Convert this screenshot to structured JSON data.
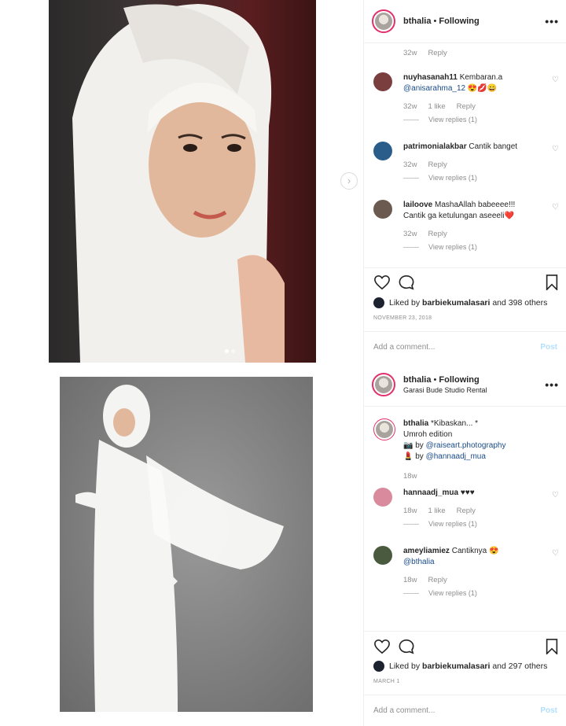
{
  "post1": {
    "header": {
      "username": "bthalia",
      "separator": " • ",
      "follow": "Following"
    },
    "top_comment_meta": {
      "time": "32w",
      "reply": "Reply"
    },
    "comments": [
      {
        "user": "nuyhasanah11",
        "text": "Kembaran.a",
        "mention": "@anisarahma_12",
        "emoji": "😍💋😄",
        "time": "32w",
        "likes": "1 like",
        "reply": "Reply",
        "view_replies": "View replies (1)",
        "avatar_color": "#7a3e3e"
      },
      {
        "user": "patrimonialakbar",
        "text": "Cantik banget",
        "time": "32w",
        "reply": "Reply",
        "view_replies": "View replies (1)",
        "avatar_color": "#2a5d8a"
      },
      {
        "user": "lailoove",
        "text": "MashaAllah babeeee!!!",
        "text2": "Cantik ga ketulungan aseeeli",
        "emoji": "❤️",
        "time": "32w",
        "reply": "Reply",
        "view_replies": "View replies (1)",
        "avatar_color": "#6b5a50"
      }
    ],
    "liked_by_prefix": "Liked by ",
    "liked_by_user": "barbiekumalasari",
    "liked_by_suffix": " and 398 others",
    "date": "NOVEMBER 23, 2018",
    "add_comment_placeholder": "Add a comment...",
    "post_label": "Post"
  },
  "post2": {
    "header": {
      "username": "bthalia",
      "separator": " • ",
      "follow": "Following",
      "location": "Garasi Bude Studio Rental"
    },
    "caption": {
      "user": "bthalia",
      "line1": "*Kibaskan... *",
      "line2": "Umroh edition",
      "photo_emoji": "📷",
      "photo_by": " by ",
      "photo_mention": "@raiseart.photography",
      "mua_emoji": "💄",
      "mua_by": " by ",
      "mua_mention": "@hannaadj_mua",
      "time": "18w"
    },
    "comments": [
      {
        "user": "hannaadj_mua",
        "text": "♥♥♥",
        "time": "18w",
        "likes": "1 like",
        "reply": "Reply",
        "view_replies": "View replies (1)",
        "avatar_color": "#d98a9c"
      },
      {
        "user": "ameyliamiez",
        "text": "Cantiknya",
        "emoji": "😍",
        "mention": "@bthalia",
        "time": "18w",
        "reply": "Reply",
        "view_replies": "View replies (1)",
        "avatar_color": "#4a5a3e"
      }
    ],
    "liked_by_prefix": "Liked by ",
    "liked_by_user": "barbiekumalasari",
    "liked_by_suffix": " and 297 others",
    "date": "MARCH 1",
    "add_comment_placeholder": "Add a comment...",
    "post_label": "Post"
  },
  "icons": {
    "more": "•••",
    "heart_small": "♡",
    "carousel_next": "›"
  }
}
